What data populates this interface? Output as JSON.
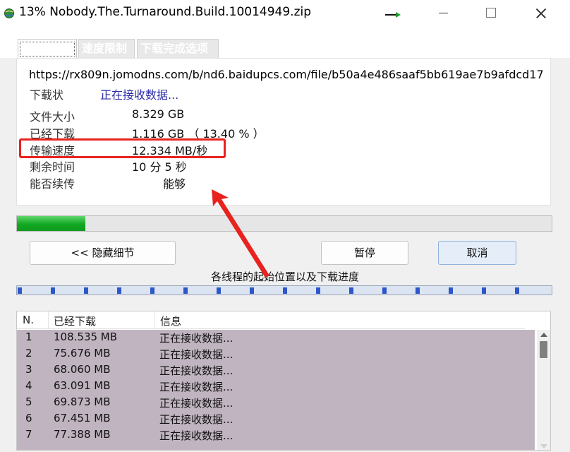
{
  "window": {
    "title": "13% Nobody.The.Turnaround.Build.10014949.zip"
  },
  "tabs": [
    {
      "label": ""
    },
    {
      "label": "速度限制"
    },
    {
      "label": "下载完成选项"
    }
  ],
  "download": {
    "url": "https://rx809n.jomodns.com/b/nd6.baidupcs.com/file/b50a4e486saaf5bb619ae7b9afdcd17",
    "status_label": "下载状",
    "status_value": "正在接收数据...",
    "size_label": "文件大小",
    "size_value": "8.329  GB",
    "downloaded_label": "已经下载",
    "downloaded_value": "1.116  GB （ 13.40 % ）",
    "speed_label": "传输速度",
    "speed_value": "12.334  MB/秒",
    "remaining_label": "剩余时间",
    "remaining_value": "10 分 5 秒",
    "resume_label": "能否续传",
    "resume_value": "能够"
  },
  "progress": {
    "fraction": 0.134
  },
  "buttons": {
    "hide_details": "<< 隐藏细节",
    "pause": "暂停",
    "cancel": "取消"
  },
  "threads": {
    "caption": "各线程的起始位置以及下载进度",
    "columns": [
      "N.",
      "已经下载",
      "信息"
    ],
    "rows": [
      {
        "n": "1",
        "downloaded": "108.535  MB",
        "info": "正在接收数据..."
      },
      {
        "n": "2",
        "downloaded": "75.676  MB",
        "info": "正在接收数据..."
      },
      {
        "n": "3",
        "downloaded": "68.060  MB",
        "info": "正在接收数据..."
      },
      {
        "n": "4",
        "downloaded": "63.091  MB",
        "info": "正在接收数据..."
      },
      {
        "n": "5",
        "downloaded": "69.873  MB",
        "info": "正在接收数据..."
      },
      {
        "n": "6",
        "downloaded": "67.451  MB",
        "info": "正在接收数据..."
      },
      {
        "n": "7",
        "downloaded": "77.388  MB",
        "info": "正在接收数据..."
      }
    ]
  },
  "colors": {
    "highlight_box": "#e8221e",
    "progress_green": "#11a822",
    "segment_blue": "#2c56c9",
    "table_rows_bg": "#bfb4bf",
    "status_blue": "#2a2aa8"
  }
}
